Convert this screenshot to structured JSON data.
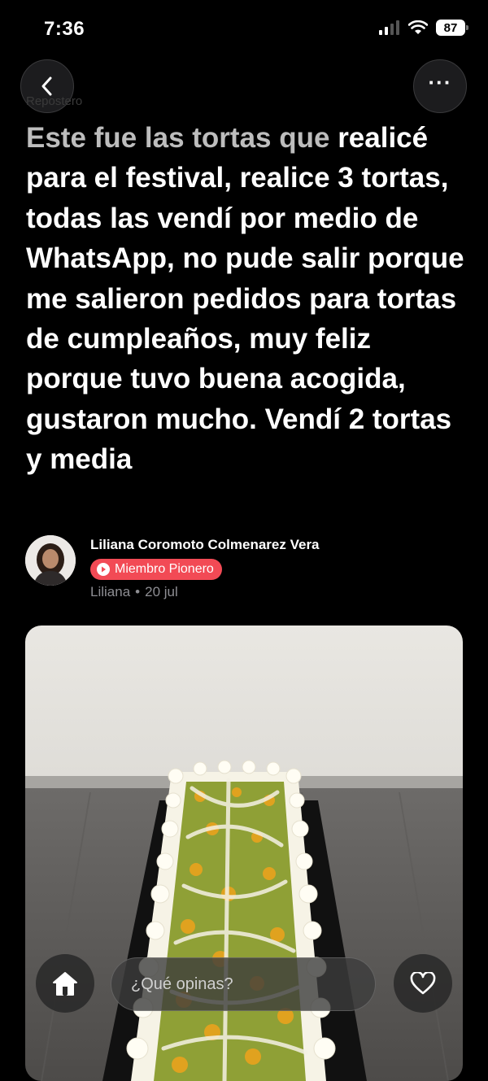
{
  "status_bar": {
    "time": "7:36",
    "battery": "87"
  },
  "header": {
    "group_label": "Repostero"
  },
  "post": {
    "title_faded": "Este fue las tortas que",
    "title_rest": "realicé para el festival, realice 3 tortas, todas las vendí por medio de WhatsApp, no pude salir porque me salieron pedidos para tortas de cumpleaños, muy feliz porque tuvo buena acogida, gustaron mucho. Vendí 2 tortas y media"
  },
  "author": {
    "name": "Liliana Coromoto Colmenarez Vera",
    "badge": "Miembro Pionero",
    "username": "Liliana",
    "date": "20 jul"
  },
  "bottom_bar": {
    "comment_placeholder": "¿Qué opinas?"
  },
  "icons": [
    "back-arrow-icon",
    "more-icon",
    "home-icon",
    "heart-icon",
    "play-badge-icon"
  ],
  "colors": {
    "badge": "#f24a55",
    "background": "#000000"
  }
}
